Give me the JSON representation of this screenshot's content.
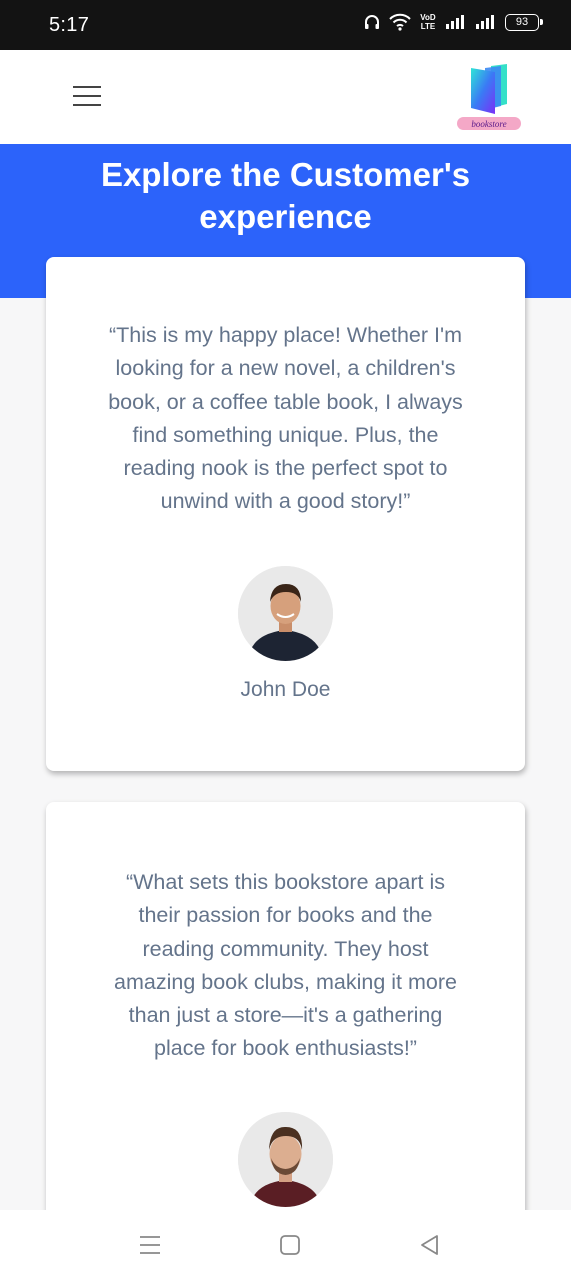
{
  "status_bar": {
    "time": "5:17",
    "network_label": "VoD LTE",
    "battery": "93"
  },
  "header": {
    "menu_icon": "hamburger-menu-icon",
    "logo_text": "bookstore"
  },
  "hero": {
    "title": "Explore the Customer's experience",
    "background_color": "#2c63fa"
  },
  "testimonials": [
    {
      "quote": "“This is my happy place! Whether I'm looking for a new novel, a children's book, or a coffee table book, I always find something unique. Plus, the reading nook is the perfect spot to unwind with a good story!”",
      "author": "John Doe",
      "avatar_icon": "avatar-portrait"
    },
    {
      "quote": "“What sets this bookstore apart is their passion for books and the reading community. They host amazing book clubs, making it more than just a store—it's a gathering place for book enthusiasts!”",
      "avatar_icon": "avatar-portrait"
    }
  ],
  "system_nav": {
    "recents_icon": "recents-icon",
    "home_icon": "home-icon",
    "back_icon": "back-icon"
  },
  "colors": {
    "accent": "#2c63fa",
    "text_muted": "#64748b",
    "page_background": "#f7f7f8"
  }
}
